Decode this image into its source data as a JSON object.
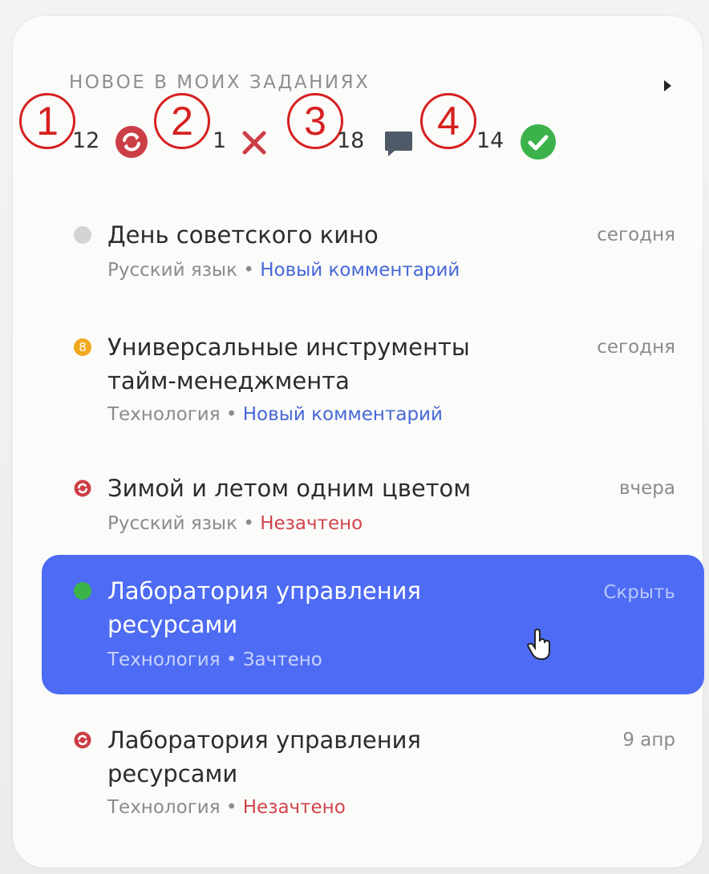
{
  "widget": {
    "title": "НОВОЕ В МОИХ ЗАДАНИЯХ",
    "icons": {
      "expand": "chevron-right-icon"
    }
  },
  "stats": [
    {
      "marker": "1",
      "count": "12",
      "icon": "rework-icon",
      "color": "#cc3e46"
    },
    {
      "marker": "2",
      "count": "1",
      "icon": "cross-icon",
      "color": "#cc3e46"
    },
    {
      "marker": "3",
      "count": "18",
      "icon": "comment-icon",
      "color": "#4f5a68"
    },
    {
      "marker": "4",
      "count": "14",
      "icon": "check-circle-icon",
      "color": "#3bb34a"
    }
  ],
  "tasks": [
    {
      "title": "День советского кино",
      "subject": "Русский язык",
      "status": "Новый комментарий",
      "date": "сегодня",
      "indicator": "grey-dot",
      "indicator_color": "#d4d4d4"
    },
    {
      "title": "Универсальные инструменты тайм-менеджмента",
      "subject": "Технология",
      "status": "Новый комментарий",
      "date": "сегодня",
      "indicator": "grade-badge",
      "indicator_color": "#f0a81d",
      "badge_text": "8"
    },
    {
      "title": "Зимой и летом одним цветом",
      "subject": "Русский язык",
      "status": "Незачтено",
      "date": "вчера",
      "indicator": "rework-icon",
      "indicator_color": "#cc3e46"
    },
    {
      "title": "Лаборатория управления ресурсами",
      "subject": "Технология",
      "status": "Зачтено",
      "action": "Скрыть",
      "indicator": "green-dot",
      "indicator_color": "#3bb34a",
      "highlight_color": "#4d6bf3"
    },
    {
      "title": "Лаборатория управления ресурсами",
      "subject": "Технология",
      "status": "Незачтено",
      "date": "9 апр",
      "indicator": "rework-icon",
      "indicator_color": "#cc3e46"
    }
  ],
  "separator": "•"
}
